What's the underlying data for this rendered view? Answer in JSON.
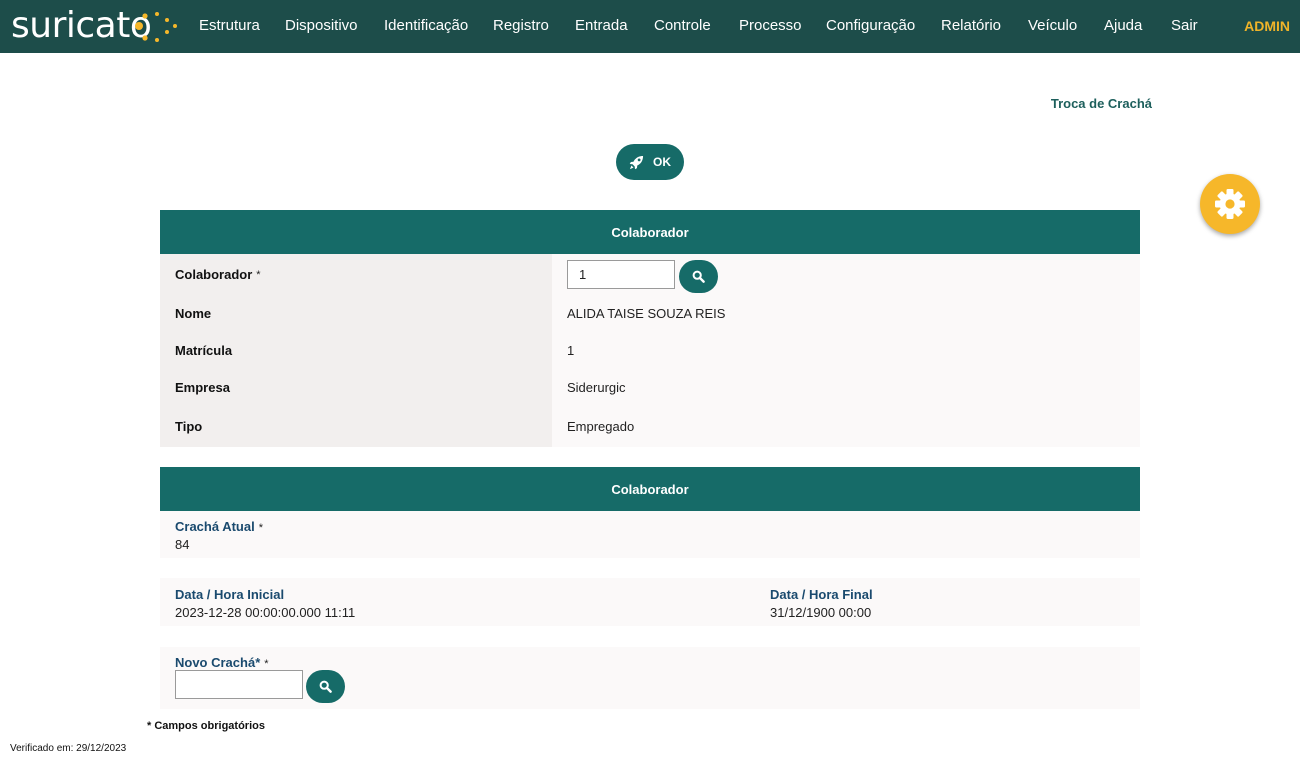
{
  "app": {
    "logo_text": "suricato",
    "nav": [
      "Estrutura",
      "Dispositivo",
      "Identificação",
      "Registro",
      "Entrada",
      "Controle",
      "Processo",
      "Configuração",
      "Relatório",
      "Veículo",
      "Ajuda",
      "Sair"
    ],
    "user": "ADMIN"
  },
  "page": {
    "title": "Troca de Crachá",
    "ok_label": "OK"
  },
  "colaborador_panel": {
    "header": "Colaborador",
    "fields": {
      "colaborador_label": "Colaborador",
      "colaborador_required": "*",
      "colaborador_value": "1",
      "nome_label": "Nome",
      "nome_value": "ALIDA TAISE SOUZA REIS",
      "matricula_label": "Matrícula",
      "matricula_value": "1",
      "empresa_label": "Empresa",
      "empresa_value": "Siderurgic",
      "tipo_label": "Tipo",
      "tipo_value": "Empregado"
    }
  },
  "cracha_panel": {
    "header": "Colaborador",
    "cracha_atual_label": "Crachá Atual",
    "cracha_atual_required": "*",
    "cracha_atual_value": "84",
    "data_inicial_label": "Data / Hora Inicial",
    "data_inicial_value": "2023-12-28 00:00:00.000 11:11",
    "data_final_label": "Data / Hora Final",
    "data_final_value": "31/12/1900 00:00",
    "novo_cracha_label": "Novo Crachá*",
    "novo_cracha_required": "*",
    "novo_cracha_value": ""
  },
  "footer": {
    "required_note": "* Campos obrigatórios",
    "verified": "Verificado em: 29/12/2023"
  },
  "colors": {
    "topbar": "#1d4d4a",
    "accent": "#166b68",
    "admin": "#f0b429",
    "fab": "#f6b72a"
  }
}
